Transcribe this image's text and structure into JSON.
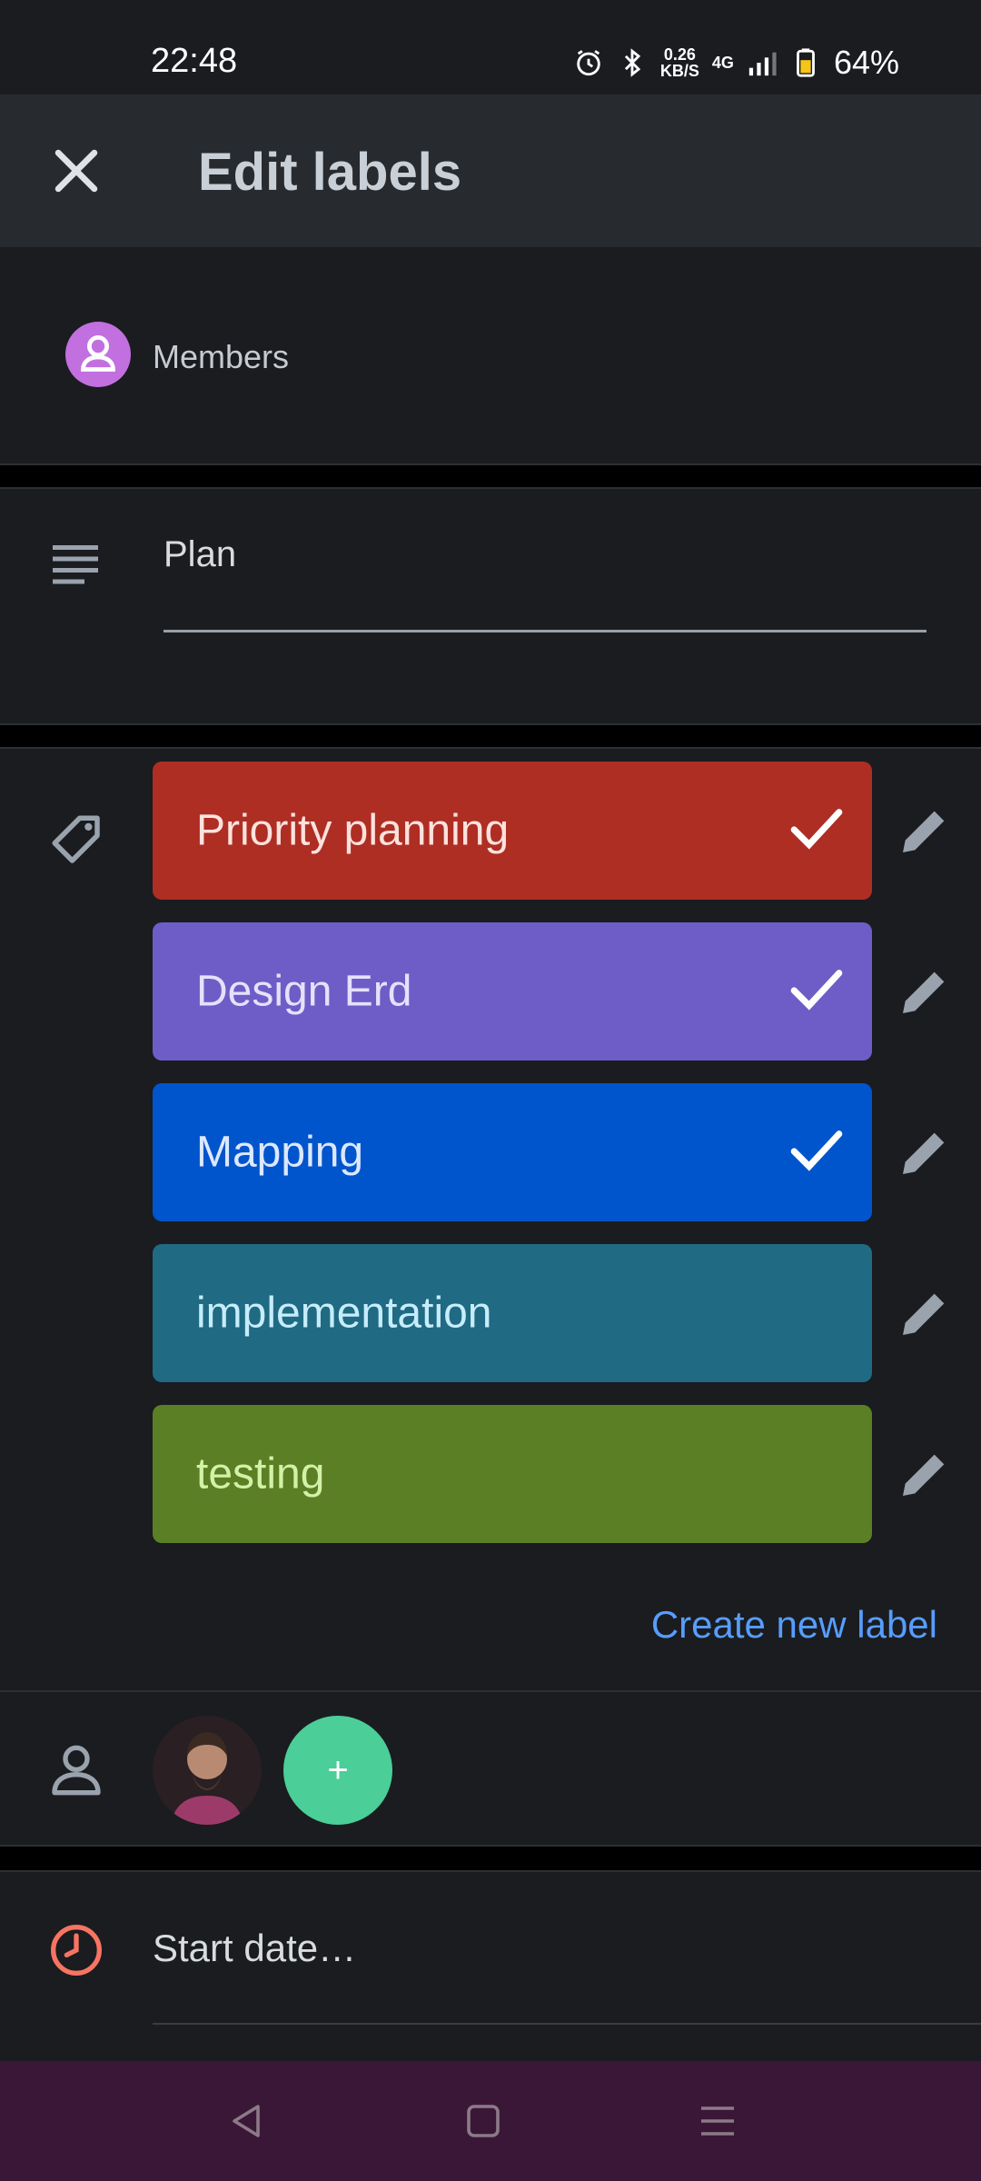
{
  "status_bar": {
    "time": "22:48",
    "net_speed_top": "0.26",
    "net_speed_bottom": "KB/S",
    "network": "4G",
    "battery": "64%",
    "icons": [
      "alarm-icon",
      "bluetooth-icon",
      "signal-icon",
      "battery-icon"
    ]
  },
  "app_bar": {
    "title": "Edit labels",
    "close_icon": "close-icon"
  },
  "members": {
    "label": "Members",
    "icon": "person-icon"
  },
  "description": {
    "value": "Plan"
  },
  "labels": {
    "items": [
      {
        "name": "Priority planning",
        "color": "#ae2e24",
        "text_color": "#fde2dd",
        "checked": true
      },
      {
        "name": "Design Erd",
        "color": "#6e5dc6",
        "text_color": "#e6e1fb",
        "checked": true
      },
      {
        "name": "Mapping",
        "color": "#0055cc",
        "text_color": "#dce8ff",
        "checked": true
      },
      {
        "name": "implementation",
        "color": "#206a83",
        "text_color": "#c6edfb",
        "checked": false
      },
      {
        "name": "testing",
        "color": "#5b7f24",
        "text_color": "#d3f1a7",
        "checked": false
      }
    ],
    "create_label": "Create new label"
  },
  "assignees": {
    "add_label": "+"
  },
  "dates": {
    "start_placeholder": "Start date…"
  },
  "colors": {
    "accent": "#579dff",
    "add_member": "#4bce97",
    "clock": "#f87462"
  }
}
